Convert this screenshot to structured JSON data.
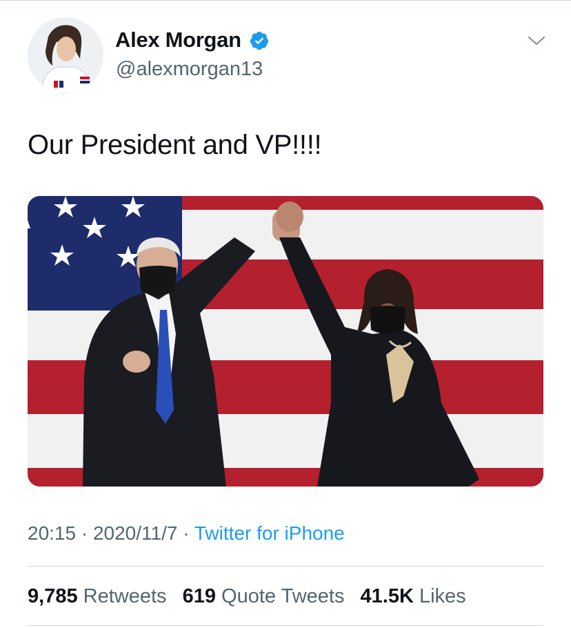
{
  "author": {
    "name": "Alex Morgan",
    "handle": "@alexmorgan13",
    "verified": true
  },
  "tweet": {
    "text": "Our President and VP!!!!"
  },
  "meta": {
    "time": "20:15",
    "separator": " · ",
    "date": "2020/11/7",
    "source": "Twitter for iPhone"
  },
  "stats": {
    "retweets_count": "9,785",
    "retweets_label": "Retweets",
    "quote_count": "619",
    "quote_label": "Quote Tweets",
    "likes_count": "41.5K",
    "likes_label": "Likes"
  },
  "icons": {
    "verified": "verified-badge-icon",
    "caret": "chevron-down-icon"
  },
  "colors": {
    "link": "#1d9bf0",
    "secondary_text": "#536471",
    "flag_red": "#b5202e",
    "flag_blue": "#1e2c6b"
  }
}
